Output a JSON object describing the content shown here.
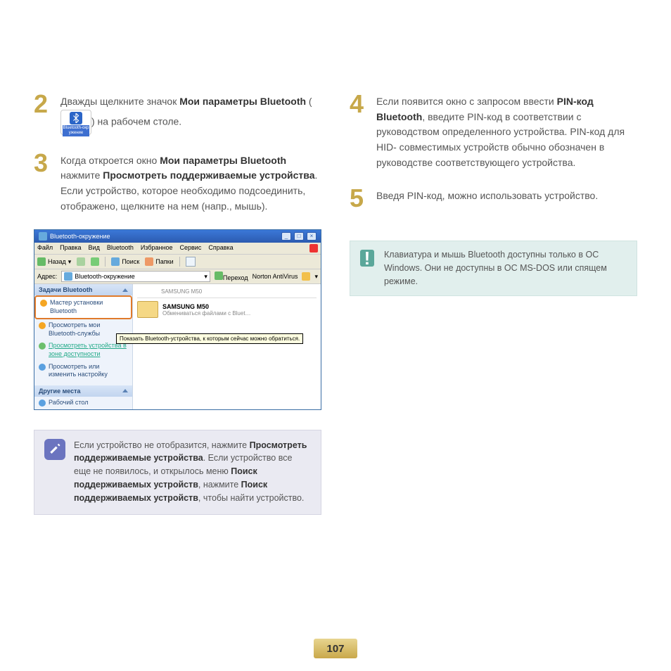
{
  "steps": {
    "s2": {
      "num": "2",
      "text_before": "Дважды щелкните значок ",
      "bold1": "Мои параметры Bluetooth",
      "text_mid": " (",
      "text_after": ") на рабочем столе.",
      "icon_label": "Bluetooth-окр\nужение"
    },
    "s3": {
      "num": "3",
      "t1": "Когда откроется окно ",
      "b1": "Мои параметры Bluetooth",
      "t2": " нажмите ",
      "b2": "Просмотреть поддерживаемые устройства",
      "t3": ". Если устройство, которое необходимо подсоединить, отображено, щелкните на нем (напр., мышь)."
    },
    "s4": {
      "num": "4",
      "t1": "Если появится окно с запросом ввести ",
      "b1": "PIN-код Bluetooth",
      "t2": ", введите PIN-код в соответствии с руководством определенного устройства. PIN-код для HID- совместимых устройств обычно обозначен в руководстве соответствующего устройства."
    },
    "s5": {
      "num": "5",
      "t1": "Введя PIN-код, можно использовать устройство."
    }
  },
  "win": {
    "title": "Bluetooth-окружение",
    "menu": [
      "Файл",
      "Правка",
      "Вид",
      "Bluetooth",
      "Избранное",
      "Сервис",
      "Справка"
    ],
    "toolbar": {
      "back": "Назад",
      "folders": "Папки",
      "search": "Поиск"
    },
    "addr_label": "Адрес:",
    "addr_value": "Bluetooth-окружение",
    "go": "Переход",
    "norton": "Norton AntiVirus",
    "side_header1": "Задачи Bluetooth",
    "side_items": [
      "Мастер установки Bluetooth",
      "Просмотреть мои Bluetooth-службы",
      "Просмотреть устройства в зоне доступности",
      "Просмотреть или изменить настройку"
    ],
    "side_header2": "Другие места",
    "side_item_other": "Рабочий стол",
    "device_name": "SAMSUNG M50",
    "device_sub1": "SAMSUNG M50",
    "device_sub2": "Обмениваться файлами с Bluet…",
    "tooltip": "Показать Bluetooth-устройства, к которым сейчас можно обратиться."
  },
  "note": {
    "t1": "Если устройство не отобразится, нажмите ",
    "b1": "Просмотреть поддерживаемые устройства",
    "t2": ". Если устройство все еще не появилось, и открылось меню ",
    "b2": "Поиск поддерживаемых устройств",
    "t3": ", нажмите ",
    "b3": "Поиск поддерживаемых устройств",
    "t4": ", чтобы найти устройство."
  },
  "alert": {
    "text": "Клавиатура и мышь Bluetooth доступны только в ОС Windows. Они не доступны в ОС MS-DOS или спящем режиме."
  },
  "page_number": "107"
}
